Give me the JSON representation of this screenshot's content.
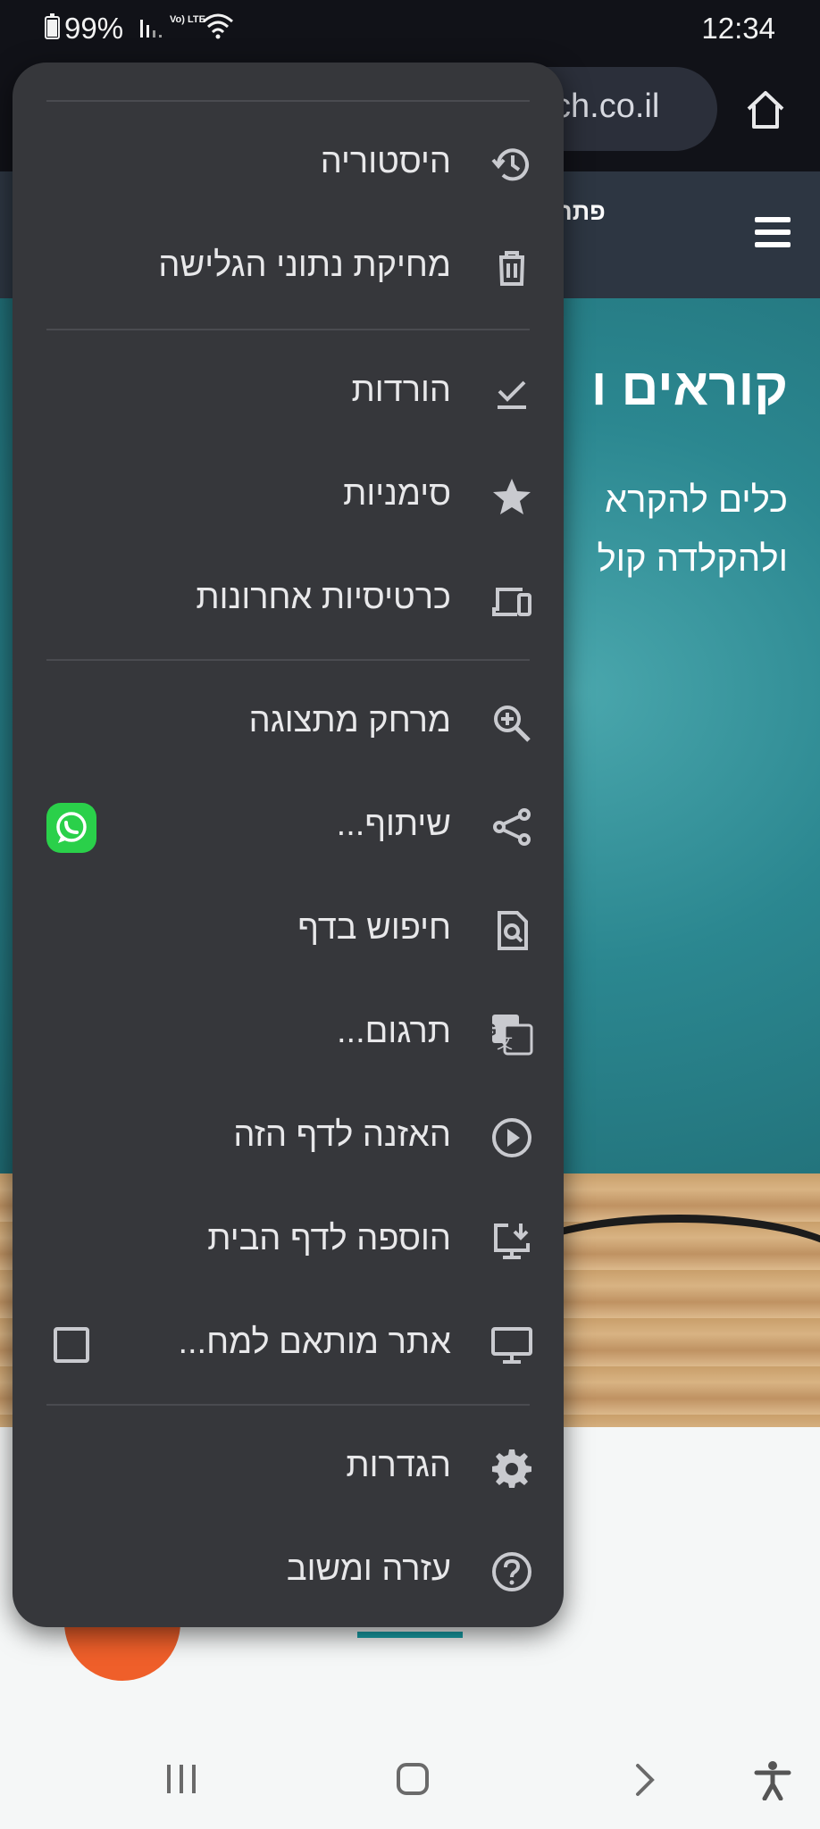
{
  "status_bar": {
    "battery": "99%",
    "signal": "lı.",
    "network": "Vo) LTE",
    "time": "12:34"
  },
  "toolbar": {
    "url_fragment": "ch.co.il"
  },
  "web": {
    "brand": "פתרו",
    "hero_title": "קוראים ו",
    "hero_sub_line1": "כלים להקרא",
    "hero_sub_line2": "ולהקלדה קול"
  },
  "menu": {
    "items": [
      {
        "label": "היסטוריה",
        "icon": "history-icon"
      },
      {
        "label": "מחיקת נתוני הגלישה",
        "icon": "trash-icon"
      },
      {
        "label": "הורדות",
        "icon": "download-check-icon"
      },
      {
        "label": "סימניות",
        "icon": "star-icon"
      },
      {
        "label": "כרטיסיות אחרונות",
        "icon": "devices-icon"
      },
      {
        "label": "מרחק מתצוגה",
        "icon": "zoom-in-icon"
      },
      {
        "label": "שיתוף...",
        "icon": "share-icon",
        "extra": "whatsapp-icon"
      },
      {
        "label": "חיפוש בדף",
        "icon": "find-in-page-icon"
      },
      {
        "label": "תרגום...",
        "icon": "translate-icon"
      },
      {
        "label": "האזנה לדף הזה",
        "icon": "play-circle-icon"
      },
      {
        "label": "הוספה לדף הבית",
        "icon": "add-to-home-icon"
      },
      {
        "label": "אתר מותאם למח...",
        "icon": "desktop-icon",
        "checked": false
      },
      {
        "label": "הגדרות",
        "icon": "gear-icon"
      },
      {
        "label": "עזרה ומשוב",
        "icon": "help-icon"
      }
    ]
  }
}
